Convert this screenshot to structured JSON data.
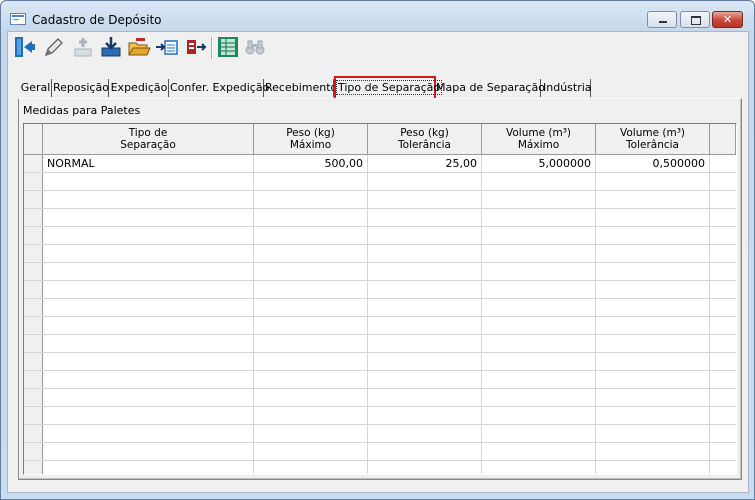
{
  "window": {
    "title": "Cadastro de Depósito",
    "close_glyph": "✕"
  },
  "toolbar": {
    "buttons": [
      {
        "name": "exit-icon",
        "color": "#1d6fb8"
      },
      {
        "name": "edit-icon",
        "color": "#6a6a6a"
      },
      {
        "name": "add-icon",
        "color": "#9aa5b4"
      },
      {
        "name": "save-icon",
        "color": "#1f4f8a"
      },
      {
        "name": "open-icon",
        "color": "#c98a1b"
      },
      {
        "name": "import-icon",
        "color": "#1d6fb8"
      },
      {
        "name": "export-icon",
        "color": "#b3222a"
      },
      {
        "name": "grid-icon",
        "color": "#1c8a5a"
      },
      {
        "name": "binoculars-icon",
        "color": "#9aa5b4"
      }
    ]
  },
  "tabs": [
    {
      "label": "Geral",
      "active": false
    },
    {
      "label": "Reposição",
      "active": false
    },
    {
      "label": "Expedição",
      "active": false
    },
    {
      "label": "Confer. Expedição",
      "active": false
    },
    {
      "label": "Recebimento",
      "active": false
    },
    {
      "label": "Tipo de Separação",
      "active": true
    },
    {
      "label": "Mapa de Separação",
      "active": false
    },
    {
      "label": "Indústria",
      "active": false
    }
  ],
  "panel": {
    "title": "Medidas para Paletes"
  },
  "grid": {
    "columns": [
      {
        "line1": "Tipo de",
        "line2": "Separação"
      },
      {
        "line1": "Peso (kg)",
        "line2": "Máximo"
      },
      {
        "line1": "Peso (kg)",
        "line2": "Tolerância"
      },
      {
        "line1": "Volume (m³)",
        "line2": "Máximo"
      },
      {
        "line1": "Volume (m³)",
        "line2": "Tolerância"
      }
    ],
    "rows": [
      {
        "tipo": "NORMAL",
        "peso_max": "500,00",
        "peso_tol": "25,00",
        "vol_max": "5,000000",
        "vol_tol": "0,500000"
      }
    ]
  },
  "accent_color": "#d11a1a"
}
